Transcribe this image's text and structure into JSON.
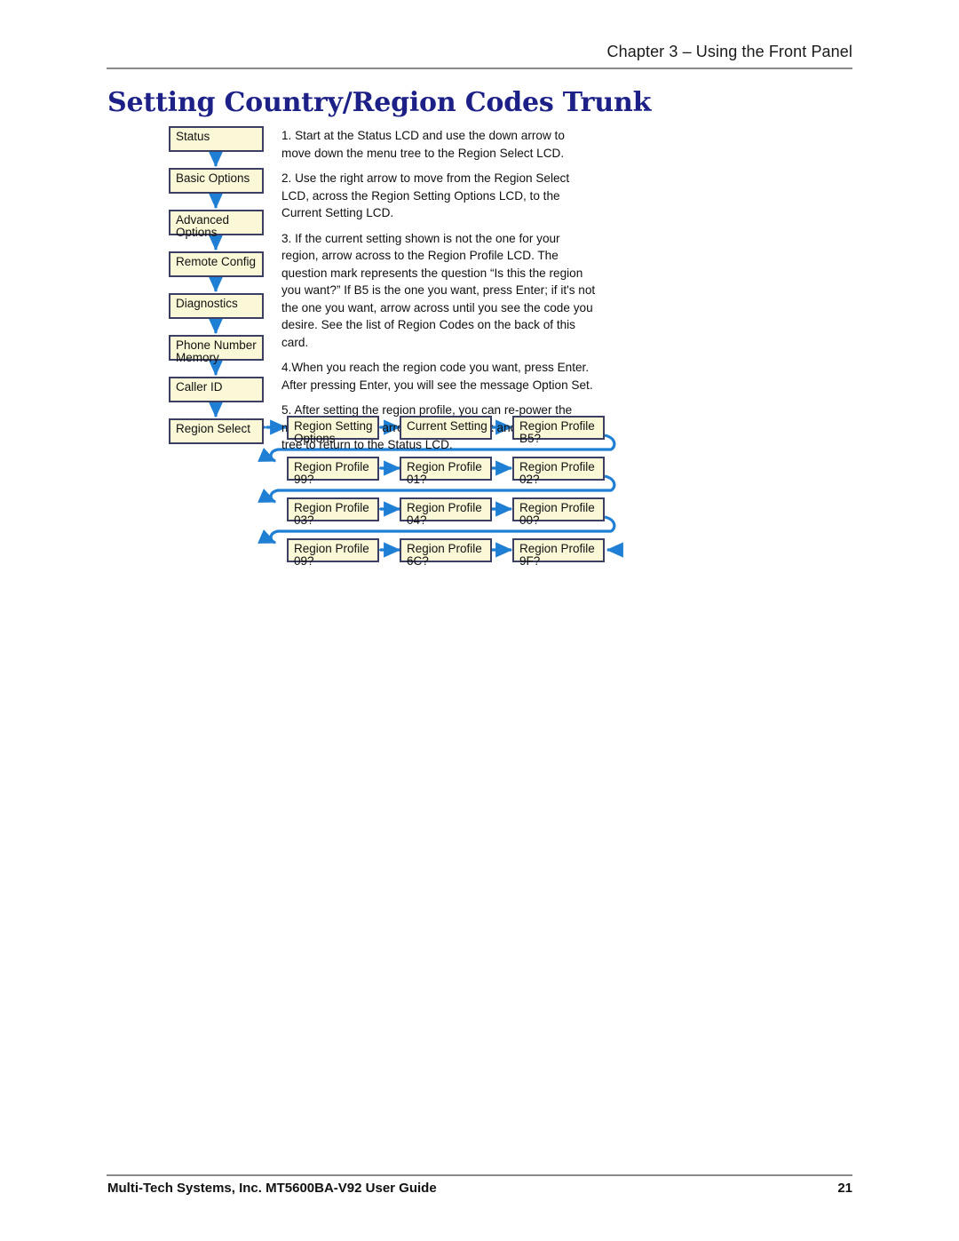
{
  "header": {
    "chapter": "Chapter 3 – Using the Front Panel"
  },
  "title": "Setting Country/Region Codes Trunk",
  "colors": {
    "title": "#1c2087",
    "box_fill": "#fbf8d7",
    "box_border": "#3b3f63",
    "arrow": "#1f7fd4",
    "rule": "#8a8a8a"
  },
  "menu_column": {
    "items": [
      {
        "line1": "Status",
        "line2": ""
      },
      {
        "line1": "Basic Options",
        "line2": ""
      },
      {
        "line1": "Advanced",
        "line2": "Options"
      },
      {
        "line1": "Remote Config",
        "line2": ""
      },
      {
        "line1": "Diagnostics",
        "line2": ""
      },
      {
        "line1": "Phone Number",
        "line2": "Memory"
      },
      {
        "line1": "Caller ID",
        "line2": ""
      },
      {
        "line1": "Region Select",
        "line2": ""
      }
    ]
  },
  "steps": [
    "1. Start at the Status LCD and use the down arrow to move down the menu tree to the Region Select LCD.",
    "2. Use the right arrow to move from the Region Select LCD, across the Region Setting Options LCD, to the Current Setting LCD.",
    "3. If the current setting shown is not the one for your region, arrow across to the Region Profile LCD. The question mark represents the question “Is this the region you want?” If B5 is the one you want, press Enter; if it's not the one you want, arrow across until you see the code you desire. See the list of Region Codes on the back of this card.",
    "4.When you reach the region code you want, press Enter. After pressing Enter, you will see the message Option Set.",
    "5. After setting the region profile, you can re-power the modem or use the arrows to move back and up the menu tree to return to the Status LCD."
  ],
  "profile_grid": {
    "rows": [
      [
        {
          "line1": "Region Setting",
          "line2": "Options"
        },
        {
          "line1": "Current Setting",
          "line2": ""
        },
        {
          "line1": "Region Profile",
          "line2": "B5?"
        }
      ],
      [
        {
          "line1": "Region Profile",
          "line2": "99?"
        },
        {
          "line1": "Region Profile",
          "line2": "01?"
        },
        {
          "line1": "Region Profile",
          "line2": "02?"
        }
      ],
      [
        {
          "line1": "Region Profile",
          "line2": "03?"
        },
        {
          "line1": "Region Profile",
          "line2": "04?"
        },
        {
          "line1": "Region Profile",
          "line2": "00?"
        }
      ],
      [
        {
          "line1": "Region Profile",
          "line2": "09?"
        },
        {
          "line1": "Region Profile",
          "line2": "6C?"
        },
        {
          "line1": "Region Profile",
          "line2": "9F?"
        }
      ]
    ]
  },
  "footer": {
    "left": "Multi-Tech Systems, Inc. MT5600BA-V92 User Guide",
    "page": "21"
  }
}
